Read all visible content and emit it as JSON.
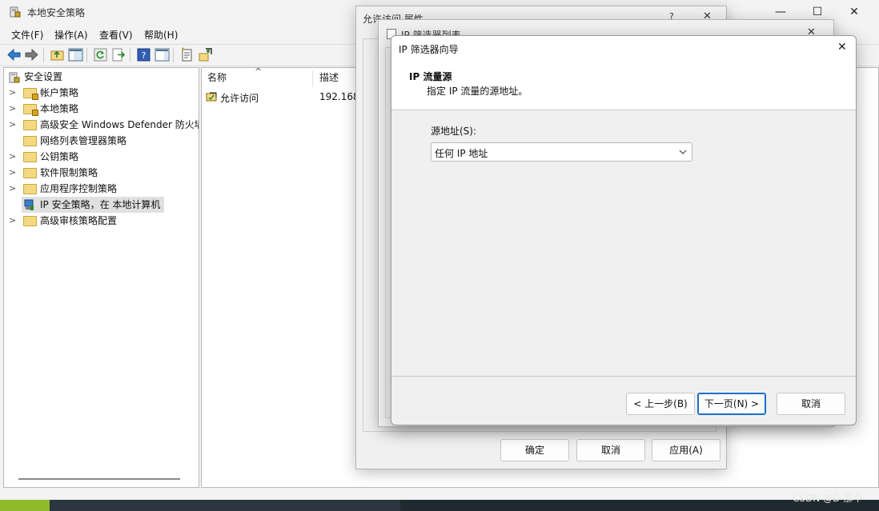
{
  "main_window": {
    "title": "本地安全策略",
    "controls": {
      "minimize": "—",
      "maximize": "☐",
      "close": "✕"
    },
    "menu": [
      "文件(F)",
      "操作(A)",
      "查看(V)",
      "帮助(H)"
    ]
  },
  "tree": {
    "root": "安全设置",
    "items": [
      {
        "label": "帐户策略",
        "expandable": true
      },
      {
        "label": "本地策略",
        "expandable": true
      },
      {
        "label": "高级安全 Windows Defender 防火墙",
        "expandable": true
      },
      {
        "label": "网络列表管理器策略",
        "expandable": false
      },
      {
        "label": "公钥策略",
        "expandable": true
      },
      {
        "label": "软件限制策略",
        "expandable": true
      },
      {
        "label": "应用程序控制策略",
        "expandable": true
      },
      {
        "label": "IP 安全策略，在 本地计算机",
        "expandable": false,
        "selected": true
      },
      {
        "label": "高级审核策略配置",
        "expandable": true
      }
    ]
  },
  "list": {
    "columns": [
      "名称",
      "描述"
    ],
    "sort_indicator": "^",
    "rows": [
      {
        "name": "允许访问",
        "desc": "192.168"
      }
    ]
  },
  "dialog_properties": {
    "title": "允许访问 属性",
    "help": "?",
    "close": "✕",
    "buttons": {
      "ok": "确定",
      "cancel": "取消",
      "apply": "应用(A)"
    }
  },
  "dialog_filter_list": {
    "title": "IP 筛选器列表",
    "close": "✕"
  },
  "wizard": {
    "title": "IP 筛选器向导",
    "close": "✕",
    "heading": "IP 流量源",
    "subheading": "指定 IP 流量的源地址。",
    "field_label": "源地址(S):",
    "field_value": "任何 IP 地址",
    "buttons": {
      "back": "< 上一步(B)",
      "next": "下一页(N) >",
      "cancel": "取消"
    }
  },
  "watermark": "CSDN @D-那个"
}
